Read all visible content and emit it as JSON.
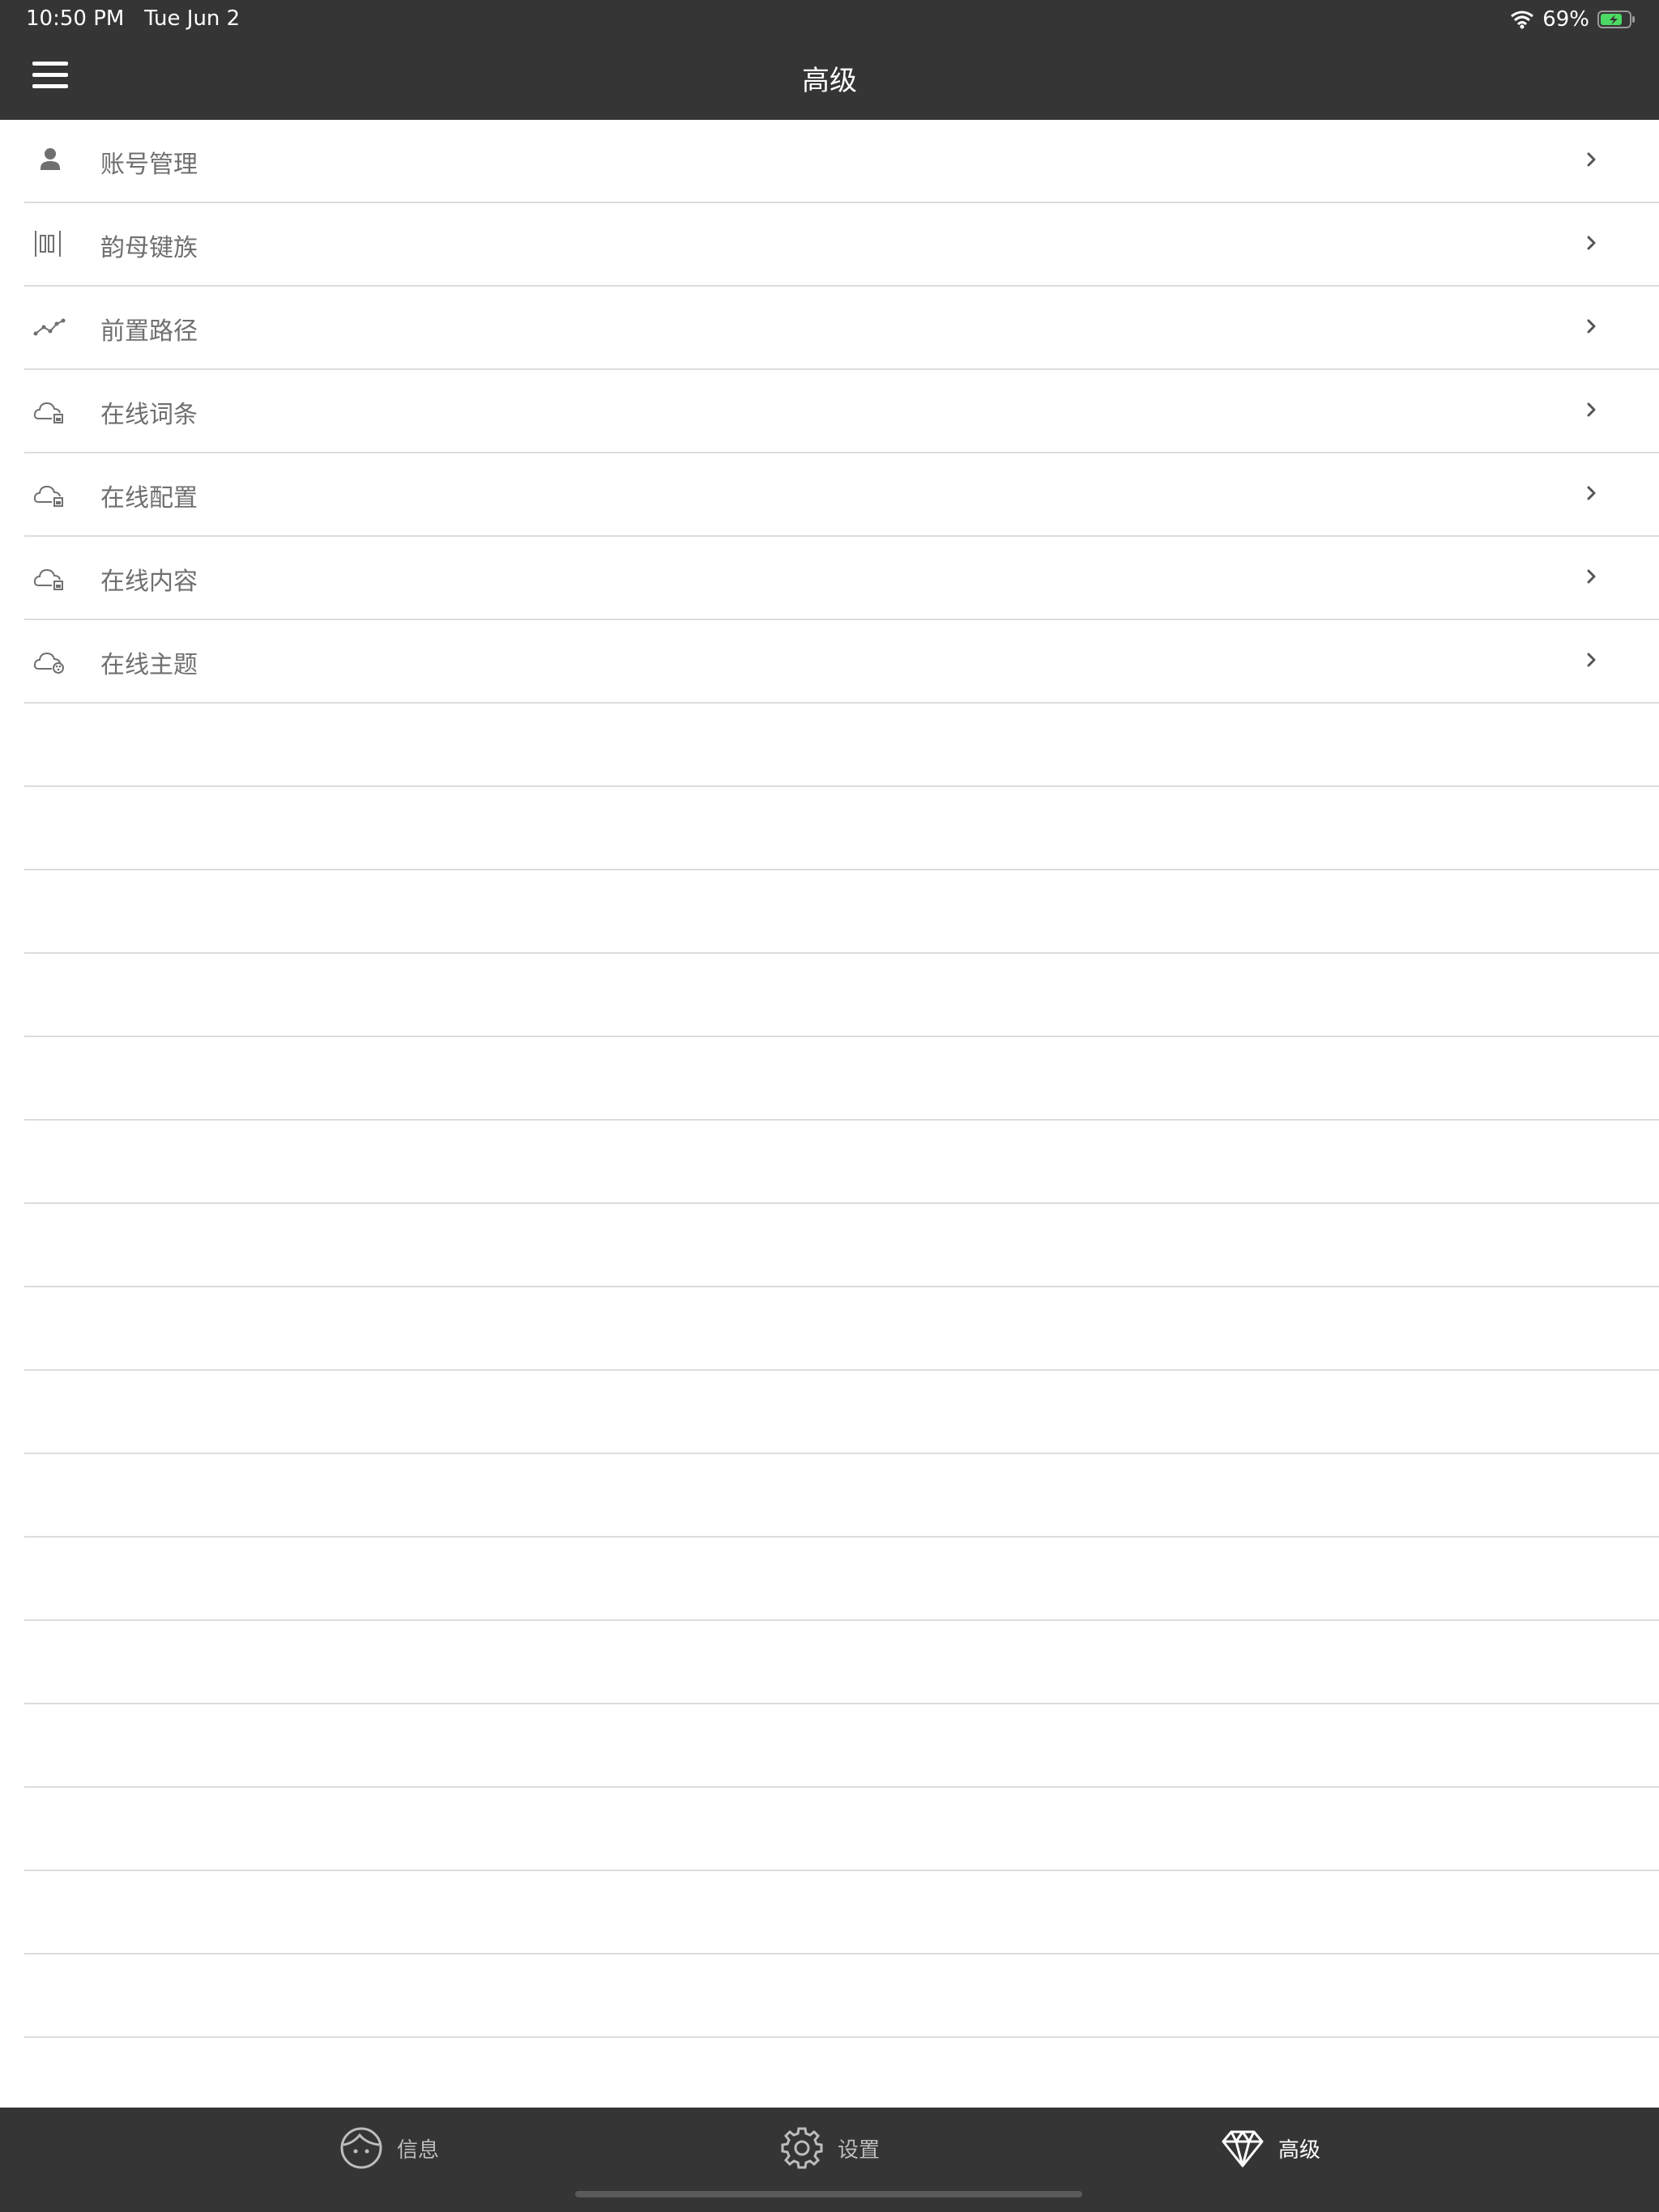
{
  "status": {
    "time": "10:50 PM",
    "date": "Tue Jun 2",
    "battery": "69%"
  },
  "header": {
    "title": "高级"
  },
  "menu": {
    "items": [
      {
        "label": "账号管理",
        "icon": "person-icon"
      },
      {
        "label": "韵母键族",
        "icon": "keys-icon"
      },
      {
        "label": "前置路径",
        "icon": "path-icon"
      },
      {
        "label": "在线词条",
        "icon": "cloud-lock-icon"
      },
      {
        "label": "在线配置",
        "icon": "cloud-lock-icon"
      },
      {
        "label": "在线内容",
        "icon": "cloud-lock-icon"
      },
      {
        "label": "在线主题",
        "icon": "cloud-palette-icon"
      }
    ]
  },
  "tabs": [
    {
      "label": "信息",
      "icon": "face-icon",
      "active": false
    },
    {
      "label": "设置",
      "icon": "gear-icon",
      "active": false
    },
    {
      "label": "高级",
      "icon": "diamond-icon",
      "active": true
    }
  ],
  "colors": {
    "bar": "#353535",
    "label": "#6f6f6f",
    "divider": "#dcdcdc",
    "battery": "#4cd964"
  }
}
